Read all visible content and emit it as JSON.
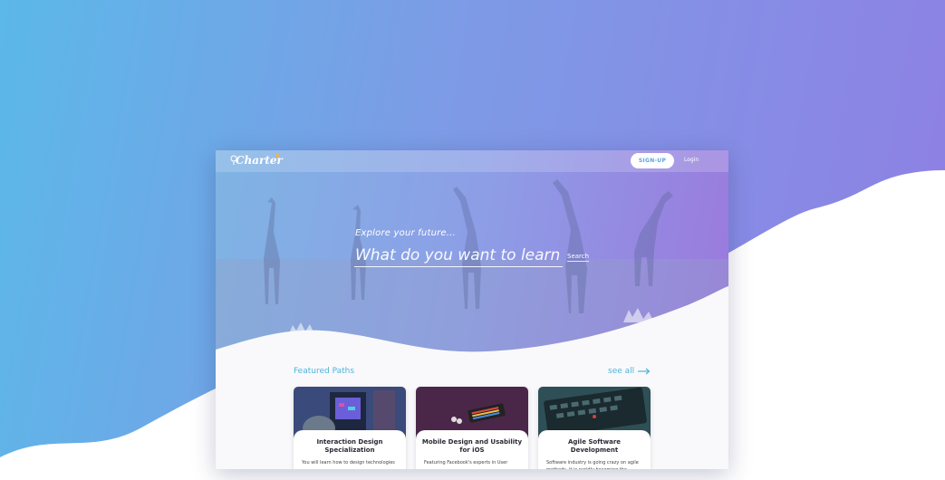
{
  "app": {
    "logo_text": "Charter",
    "brand_accent": "#f5b04a"
  },
  "nav": {
    "signup_label": "SIGN-UP",
    "login_label": "Login"
  },
  "hero": {
    "tagline": "Explore your future...",
    "search_placeholder": "What do you want to learn?",
    "search_button_label": "Search"
  },
  "featured": {
    "section_title": "Featured Paths",
    "see_all_label": "see all",
    "see_all_icon": "arrow-right-icon",
    "cards": [
      {
        "title": "Interaction Design Specialization",
        "description": "You will learn how to design technologies"
      },
      {
        "title": "Mobile Design and Usability for iOS",
        "description": "Featuring Facebook's experts in User"
      },
      {
        "title": "Agile Software Development",
        "description": "Software industry is going crazy on agile methods.  It is rapidly becoming the"
      }
    ]
  },
  "colors": {
    "accent_blue": "#4fb3dd",
    "hero_gradient_start": "#7fb4e4",
    "hero_gradient_end": "#9b79dd"
  }
}
